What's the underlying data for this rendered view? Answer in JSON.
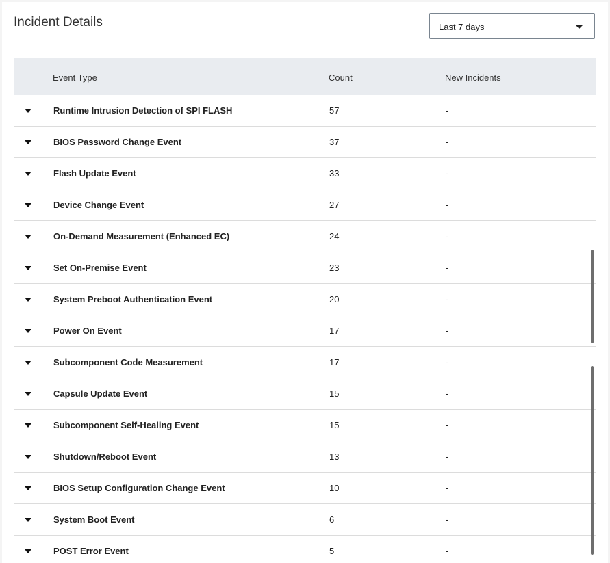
{
  "header": {
    "title": "Incident Details",
    "range_select": {
      "value": "Last 7 days"
    }
  },
  "table": {
    "columns": [
      "Event Type",
      "Count",
      "New Incidents"
    ],
    "rows": [
      {
        "type": "Runtime Intrusion Detection of SPI FLASH",
        "count": "57",
        "new": "-"
      },
      {
        "type": "BIOS Password Change Event",
        "count": "37",
        "new": "-"
      },
      {
        "type": "Flash Update Event",
        "count": "33",
        "new": "-"
      },
      {
        "type": "Device Change Event",
        "count": "27",
        "new": "-"
      },
      {
        "type": "On-Demand Measurement (Enhanced EC)",
        "count": "24",
        "new": "-"
      },
      {
        "type": "Set On-Premise Event",
        "count": "23",
        "new": "-"
      },
      {
        "type": "System Preboot Authentication Event",
        "count": "20",
        "new": "-"
      },
      {
        "type": "Power On Event",
        "count": "17",
        "new": "-"
      },
      {
        "type": "Subcomponent Code Measurement",
        "count": "17",
        "new": "-"
      },
      {
        "type": "Capsule Update Event",
        "count": "15",
        "new": "-"
      },
      {
        "type": "Subcomponent Self-Healing Event",
        "count": "15",
        "new": "-"
      },
      {
        "type": "Shutdown/Reboot Event",
        "count": "13",
        "new": "-"
      },
      {
        "type": "BIOS Setup Configuration Change Event",
        "count": "10",
        "new": "-"
      },
      {
        "type": "System Boot Event",
        "count": "6",
        "new": "-"
      },
      {
        "type": "POST Error Event",
        "count": "5",
        "new": "-"
      }
    ]
  }
}
